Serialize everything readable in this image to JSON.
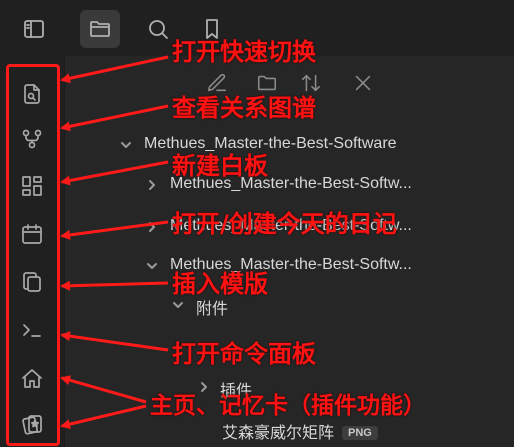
{
  "colors": {
    "annotation": "#ff1212",
    "background": "#262626",
    "sidebar": "#202020"
  },
  "topbar": {
    "icons": [
      "sidebar-toggle-icon",
      "folder-icon",
      "search-icon",
      "bookmark-icon"
    ]
  },
  "ribbon": {
    "icons": [
      "quick-switcher-icon",
      "graph-view-icon",
      "canvas-icon",
      "daily-note-icon",
      "template-icon",
      "terminal-icon",
      "home-icon",
      "flashcard-icon"
    ]
  },
  "file_tree": {
    "root": "Methues_Master-the-Best-Software",
    "rows": [
      {
        "label": "Methues_Master-the-Best-Softw..."
      },
      {
        "label": "Methues_Master-the-Best-Softw..."
      },
      {
        "label": "Methues_Master-the-Best-Softw..."
      },
      {
        "label": "附件"
      },
      {
        "label": "插件"
      },
      {
        "label": "艾森豪威尔矩阵",
        "badge": "PNG"
      }
    ]
  },
  "annotations": {
    "quick_switcher": "打开快速切换",
    "graph_view": "查看关系图谱",
    "new_canvas": "新建白板",
    "daily_note": "打开/创建今天的日记",
    "insert_template": "插入模版",
    "command_palette": "打开命令面板",
    "home_flashcards": "主页、记忆卡（插件功能）"
  }
}
